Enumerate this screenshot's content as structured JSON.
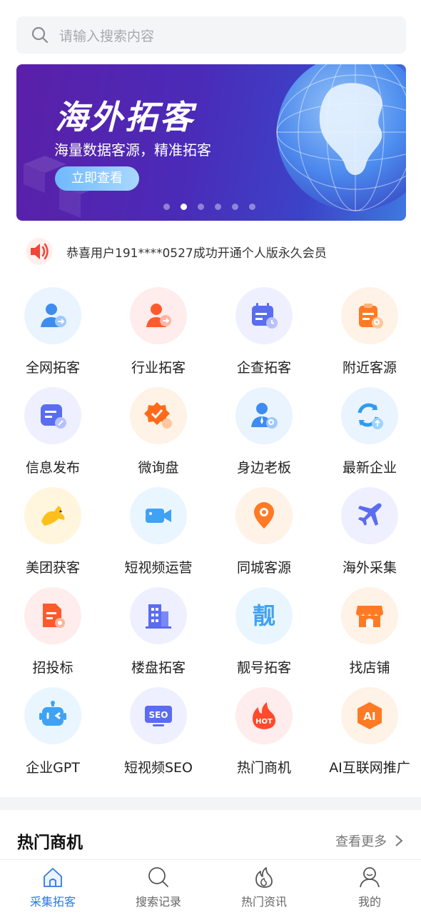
{
  "search": {
    "placeholder": "请输入搜索内容"
  },
  "banner": {
    "title": "海外拓客",
    "subtitle": "海量数据客源，精准拓客",
    "button_label": "立即查看",
    "slide_count": 6,
    "active_slide": 2
  },
  "notice": {
    "text": "恭喜用户191****0527成功开通个人版永久会员"
  },
  "features": [
    {
      "label": "全网拓客",
      "icon": "user-search-icon",
      "color": "#3e8cf0"
    },
    {
      "label": "行业拓客",
      "icon": "user-arrow-icon",
      "color": "#ff5a2c"
    },
    {
      "label": "企查拓客",
      "icon": "calendar-clock-icon",
      "color": "#5a6cf0"
    },
    {
      "label": "附近客源",
      "icon": "clipboard-search-icon",
      "color": "#ff7a24"
    },
    {
      "label": "信息发布",
      "icon": "message-edit-icon",
      "color": "#5a6cf0"
    },
    {
      "label": "微询盘",
      "icon": "badge-check-icon",
      "color": "#ff6a1a"
    },
    {
      "label": "身边老板",
      "icon": "boss-search-icon",
      "color": "#3e8cf0"
    },
    {
      "label": "最新企业",
      "icon": "refresh-upload-icon",
      "color": "#2f9bf0"
    },
    {
      "label": "美团获客",
      "icon": "kangaroo-icon",
      "color": "#ffbf1a"
    },
    {
      "label": "短视频运营",
      "icon": "video-camera-icon",
      "color": "#3fa2f5"
    },
    {
      "label": "同城客源",
      "icon": "location-pin-icon",
      "color": "#ff7a24"
    },
    {
      "label": "海外采集",
      "icon": "airplane-icon",
      "color": "#5a6cf0"
    },
    {
      "label": "招投标",
      "icon": "certificate-icon",
      "color": "#ff5a2c"
    },
    {
      "label": "楼盘拓客",
      "icon": "building-icon",
      "color": "#5a6cf0"
    },
    {
      "label": "靓号拓客",
      "icon": "liang-char-icon",
      "color": "#3fa2f5"
    },
    {
      "label": "找店铺",
      "icon": "shop-icon",
      "color": "#ff7a24"
    },
    {
      "label": "企业GPT",
      "icon": "robot-icon",
      "color": "#3fa2f5"
    },
    {
      "label": "短视频SEO",
      "icon": "seo-monitor-icon",
      "color": "#5a6cf0"
    },
    {
      "label": "热门商机",
      "icon": "hot-fire-icon",
      "color": "#ff4a2c"
    },
    {
      "label": "AI互联网推广",
      "icon": "ai-hexagon-icon",
      "color": "#ff7a24"
    }
  ],
  "hot": {
    "title": "热门商机",
    "more_label": "查看更多"
  },
  "tabs": [
    {
      "label": "采集拓客",
      "icon": "home-icon",
      "active": true
    },
    {
      "label": "搜索记录",
      "icon": "search-icon",
      "active": false
    },
    {
      "label": "热门资讯",
      "icon": "fire-icon",
      "active": false
    },
    {
      "label": "我的",
      "icon": "user-icon",
      "active": false
    }
  ],
  "colors": {
    "accent": "#2f7ae5",
    "banner_start": "#5b1fa8",
    "banner_end": "#3f78e0"
  },
  "glyphs": {
    "liang_char": "靓",
    "hot_text": "HOT",
    "seo_text": "SEO",
    "ai_text": "AI"
  }
}
